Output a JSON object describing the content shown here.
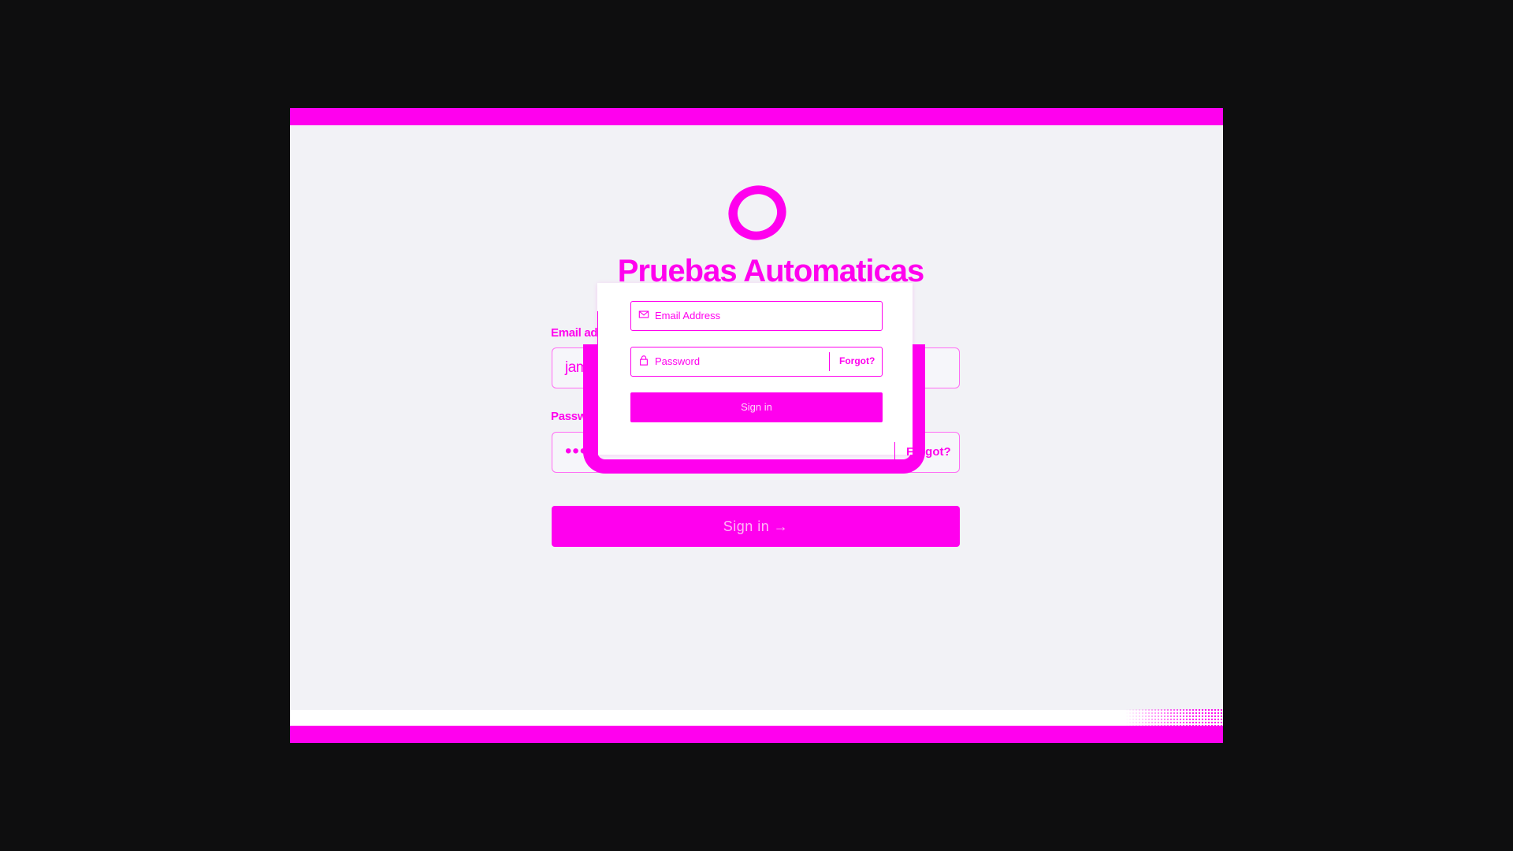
{
  "app": {
    "title": "Pruebas Automaticas",
    "logo_icon": "ring-logo-icon"
  },
  "colors": {
    "accent": "#ff00ee",
    "background": "#0e0e0f",
    "panel": "#f2f2f6"
  },
  "form": {
    "email_label": "Email address",
    "email_value": "james@example.com",
    "password_label": "Password",
    "password_value": "••••••••••••••••",
    "forgot_label": "Forgot?",
    "signin_label": "Sign in →"
  },
  "overlay_form": {
    "email_placeholder": "Email Address",
    "email_icon": "envelope-icon",
    "password_placeholder": "Password",
    "password_icon": "lock-icon",
    "forgot_label": "Forgot?",
    "signin_label": "Sign in"
  }
}
